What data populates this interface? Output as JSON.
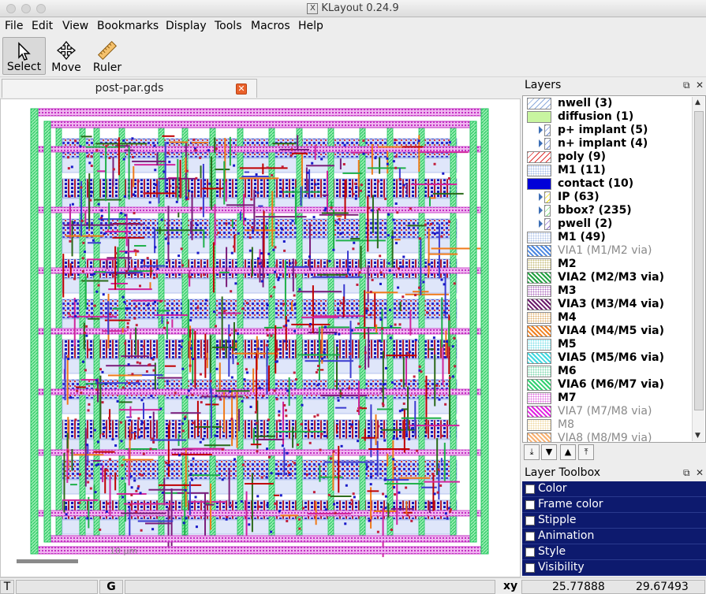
{
  "window": {
    "title": "KLayout 0.24.9"
  },
  "menu": [
    "File",
    "Edit",
    "View",
    "Bookmarks",
    "Display",
    "Tools",
    "Macros",
    "Help"
  ],
  "toolbar": {
    "select": "Select",
    "move": "Move",
    "ruler": "Ruler"
  },
  "tab": {
    "name": "post-par.gds"
  },
  "canvas": {
    "scale_label": "10 µm"
  },
  "layers_panel": {
    "title": "Layers",
    "items": [
      {
        "name": "nwell (3)",
        "color": "#8aa9dc",
        "pattern": "hatch",
        "style": "bold"
      },
      {
        "name": "diffusion (1)",
        "color": "#c8f5a0",
        "pattern": "solid",
        "style": "bold"
      },
      {
        "name": "p+ implant (5)",
        "color": "#6f8fd8",
        "pattern": "hatch",
        "style": "bold",
        "expandable": true
      },
      {
        "name": "n+ implant (4)",
        "color": "#6f8fd8",
        "pattern": "hatch",
        "style": "bold",
        "expandable": true
      },
      {
        "name": "poly (9)",
        "color": "#e03030",
        "pattern": "hatch",
        "style": "bold"
      },
      {
        "name": "M1 (11)",
        "color": "#a8bfe8",
        "pattern": "dots",
        "style": "bold"
      },
      {
        "name": "contact (10)",
        "color": "#0000d8",
        "pattern": "solid",
        "style": "bold"
      },
      {
        "name": "IP (63)",
        "color": "#f0e000",
        "pattern": "hatch",
        "style": "bold",
        "expandable": true
      },
      {
        "name": "bbox? (235)",
        "color": "#80e080",
        "pattern": "hatch",
        "style": "bold",
        "expandable": true
      },
      {
        "name": "pwell (2)",
        "color": "#9070d0",
        "pattern": "hatch",
        "style": "bold",
        "expandable": true
      },
      {
        "name": "M1 (49)",
        "color": "#b0c4e8",
        "pattern": "dots",
        "style": "bold"
      },
      {
        "name": "VIA1 (M1/M2 via)",
        "color": "#4a86e0",
        "pattern": "cross",
        "style": "dim"
      },
      {
        "name": "M2",
        "color": "#c8c080",
        "pattern": "dots",
        "style": "bold"
      },
      {
        "name": "VIA2 (M2/M3 via)",
        "color": "#20a040",
        "pattern": "cross",
        "style": "bold"
      },
      {
        "name": "M3",
        "color": "#b070c0",
        "pattern": "dots",
        "style": "bold"
      },
      {
        "name": "VIA3 (M3/M4 via)",
        "color": "#6a1a6a",
        "pattern": "cross",
        "style": "bold"
      },
      {
        "name": "M4",
        "color": "#e0b070",
        "pattern": "dots",
        "style": "bold"
      },
      {
        "name": "VIA4 (M4/M5 via)",
        "color": "#f08020",
        "pattern": "cross",
        "style": "bold"
      },
      {
        "name": "M5",
        "color": "#80e0e8",
        "pattern": "dots",
        "style": "bold"
      },
      {
        "name": "VIA5 (M5/M6 via)",
        "color": "#40d8e0",
        "pattern": "cross",
        "style": "bold"
      },
      {
        "name": "M6",
        "color": "#80d8b0",
        "pattern": "dots",
        "style": "bold"
      },
      {
        "name": "VIA6 (M6/M7 via)",
        "color": "#30d070",
        "pattern": "cross",
        "style": "bold"
      },
      {
        "name": "M7",
        "color": "#e070e0",
        "pattern": "dots",
        "style": "bold"
      },
      {
        "name": "VIA7 (M7/M8 via)",
        "color": "#e020e0",
        "pattern": "cross",
        "style": "dim"
      },
      {
        "name": "M8",
        "color": "#f0d8a0",
        "pattern": "dots",
        "style": "dim"
      },
      {
        "name": "VIA8 (M8/M9 via)",
        "color": "#f8b070",
        "pattern": "cross",
        "style": "dim"
      }
    ]
  },
  "layer_toolbox": {
    "title": "Layer Toolbox",
    "items": [
      "Color",
      "Frame color",
      "Stipple",
      "Animation",
      "Style",
      "Visibility"
    ]
  },
  "status": {
    "t_label": "T",
    "g_label": "G",
    "xy_label": "xy",
    "x": "25.77888",
    "y": "29.67493"
  }
}
